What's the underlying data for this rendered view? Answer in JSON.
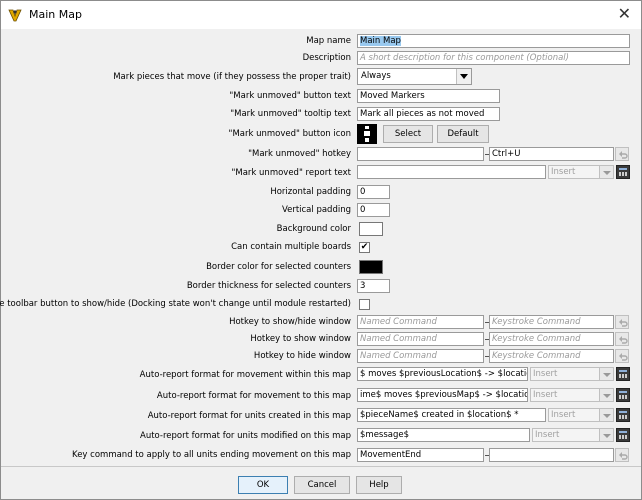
{
  "window": {
    "title": "Main Map",
    "close_glyph": "✕"
  },
  "fields": {
    "map_name": {
      "label": "Map name",
      "value": "Main Map"
    },
    "description": {
      "label": "Description",
      "placeholder": "A short description for this component (Optional)"
    },
    "mark_pieces": {
      "label": "Mark pieces that move (if they possess the proper trait)",
      "value": "Always"
    },
    "unmoved_button_text": {
      "label": "\"Mark unmoved\" button text",
      "value": "Moved Markers"
    },
    "unmoved_tooltip": {
      "label": "\"Mark unmoved\" tooltip text",
      "value": "Mark all pieces as not moved"
    },
    "unmoved_icon": {
      "label": "\"Mark unmoved\" button icon",
      "select_label": "Select",
      "default_label": "Default"
    },
    "unmoved_hotkey": {
      "label": "\"Mark unmoved\" hotkey",
      "value": "",
      "keystroke": "Ctrl+U"
    },
    "unmoved_report": {
      "label": "\"Mark unmoved\" report text",
      "value": "",
      "insert": "Insert"
    },
    "horizontal_padding": {
      "label": "Horizontal padding",
      "value": "0"
    },
    "vertical_padding": {
      "label": "Vertical padding",
      "value": "0"
    },
    "background_color": {
      "label": "Background color",
      "color": "#ffffff"
    },
    "multiple_boards": {
      "label": "Can contain multiple boards",
      "checked": "✔"
    },
    "border_color": {
      "label": "Border color for selected counters",
      "color": "#000000"
    },
    "border_thickness": {
      "label": "Border thickness for selected counters",
      "value": "3"
    },
    "toolbar_button": {
      "label": "Include toolbar button to show/hide (Docking state won't change until module restarted)"
    },
    "hotkey_showhide": {
      "label": "Hotkey to show/hide window",
      "named_placeholder": "Named Command",
      "key_placeholder": "Keystroke Command"
    },
    "hotkey_show": {
      "label": "Hotkey to show window",
      "named_placeholder": "Named Command",
      "key_placeholder": "Keystroke Command"
    },
    "hotkey_hide": {
      "label": "Hotkey to hide window",
      "named_placeholder": "Named Command",
      "key_placeholder": "Keystroke Command"
    },
    "report_within": {
      "label": "Auto-report format for movement within this map",
      "value": "$ moves $previousLocation$ -> $location$ *",
      "insert": "Insert"
    },
    "report_to": {
      "label": "Auto-report format for movement to this map",
      "value": "ime$ moves $previousMap$ -> $location$ *",
      "insert": "Insert"
    },
    "report_created": {
      "label": "Auto-report format for units created in this map",
      "value": "$pieceName$ created in $location$ *",
      "insert": "Insert"
    },
    "report_modified": {
      "label": "Auto-report format for units modified on this map",
      "value": "$message$",
      "insert": "Insert"
    },
    "key_command": {
      "label": "Key command to apply to all units ending movement on this map",
      "value": "MovementEnd",
      "keystroke": ""
    }
  },
  "buttons": {
    "ok": "OK",
    "cancel": "Cancel",
    "help": "Help"
  }
}
